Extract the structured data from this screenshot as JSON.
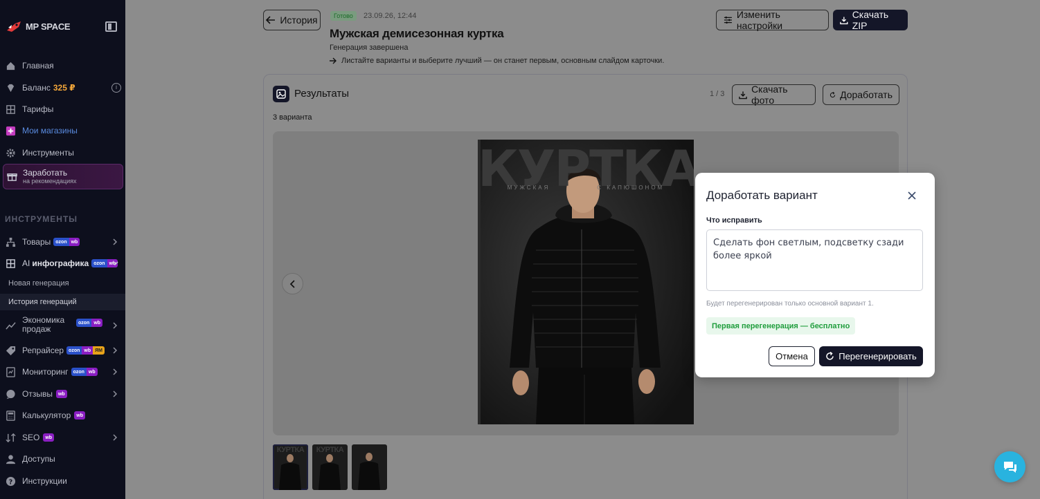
{
  "sidebar": {
    "logo_text": "MP SPACE",
    "nav": {
      "home": "Главная",
      "balance_label": "Баланс",
      "balance_value": "325 ₽",
      "tariffs": "Тарифы",
      "my_shops": "Мои магазины",
      "tools": "Инструменты"
    },
    "promo": {
      "title": "Заработать",
      "subtitle": "на рекомендациях"
    },
    "section_label": "ИНСТРУМЕНТЫ",
    "tools": {
      "goods": "Товары",
      "ai_prefix": "AI",
      "ai_strong": "инфографика",
      "new_generation": "Новая генерация",
      "history": "История генераций",
      "economy": "Экономика продаж",
      "repricer": "Репрайсер",
      "monitoring": "Мониторинг",
      "reviews": "Отзывы",
      "calculator": "Калькулятор",
      "seo": "SEO",
      "access": "Доступы",
      "instructions": "Инструкции"
    },
    "badges": {
      "ozon": "ozon",
      "wb": "wb",
      "ym": "ЯМ"
    }
  },
  "header": {
    "back_label": "История",
    "status": "Готово",
    "timestamp": "23.09.26, 12:44",
    "title": "Мужская демисезонная куртка",
    "generation_status": "Генерация завершена",
    "hint": "Листайте варианты и выберите лучший — он станет первым, основным слайдом карточки.",
    "settings_label": "Изменить настройки",
    "zip_label": "Скачать ZIP"
  },
  "results": {
    "title": "Результаты",
    "counter": "1 / 3",
    "download_photo": "Скачать фото",
    "rework": "Доработать",
    "variants_count": "3 варианта",
    "poster_title": "КУРТКА",
    "poster_sub_left": "МУЖСКАЯ",
    "poster_sub_right": "С КАПЮШОНОМ",
    "thumb_title": "КУРТКА"
  },
  "modal": {
    "title": "Доработать вариант",
    "field_label": "Что исправить",
    "textarea_value": "Сделать фон светлым, подсветку сзади более яркой",
    "note": "Будет перегенерирован только основной вариант 1.",
    "free_label": "Первая перегенерация — бесплатно",
    "cancel_label": "Отмена",
    "regen_label": "Перегенерировать"
  },
  "colors": {
    "sidebar_bg": "#0d0f1d",
    "accent_dark": "#141628",
    "balance": "#f4a73a",
    "free_green": "#1f9d3c",
    "chat_fab": "#29b3df"
  }
}
